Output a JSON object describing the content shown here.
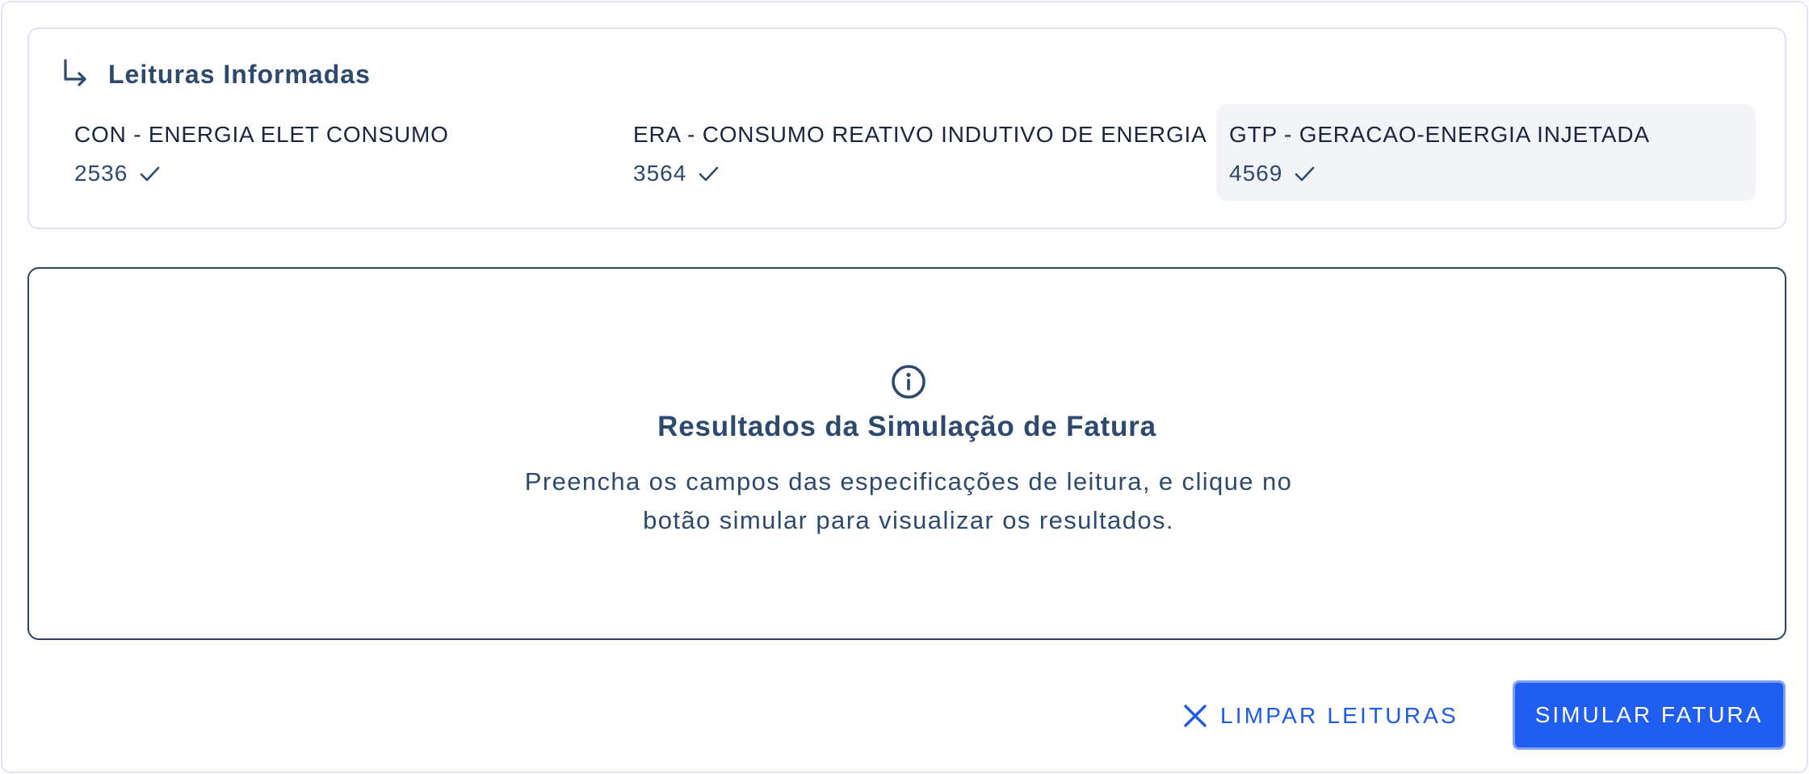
{
  "readings": {
    "title": "Leituras Informadas",
    "items": [
      {
        "label": "CON - ENERGIA ELET CONSUMO",
        "value": "2536",
        "status_icon": "check-icon"
      },
      {
        "label": "ERA - CONSUMO REATIVO INDUTIVO DE ENERGIA",
        "value": "3564",
        "status_icon": "check-icon"
      },
      {
        "label": "GTP - GERACAO-ENERGIA INJETADA",
        "value": "4569",
        "status_icon": "check-icon",
        "highlighted": true
      }
    ]
  },
  "results": {
    "icon": "info-icon",
    "title": "Resultados da Simulação de Fatura",
    "line1": "Preencha os campos das especificações de leitura, e clique no",
    "line2": "botão simular para visualizar os resultados."
  },
  "actions": {
    "clear_label": "LIMPAR LEITURAS",
    "simulate_label": "SIMULAR FATURA"
  },
  "colors": {
    "primary": "#1f5ef0",
    "text_dark": "#1b2540",
    "text_muted": "#2d4a6e",
    "border": "#dfe2f0",
    "highlight_bg": "#f3f4f8"
  }
}
